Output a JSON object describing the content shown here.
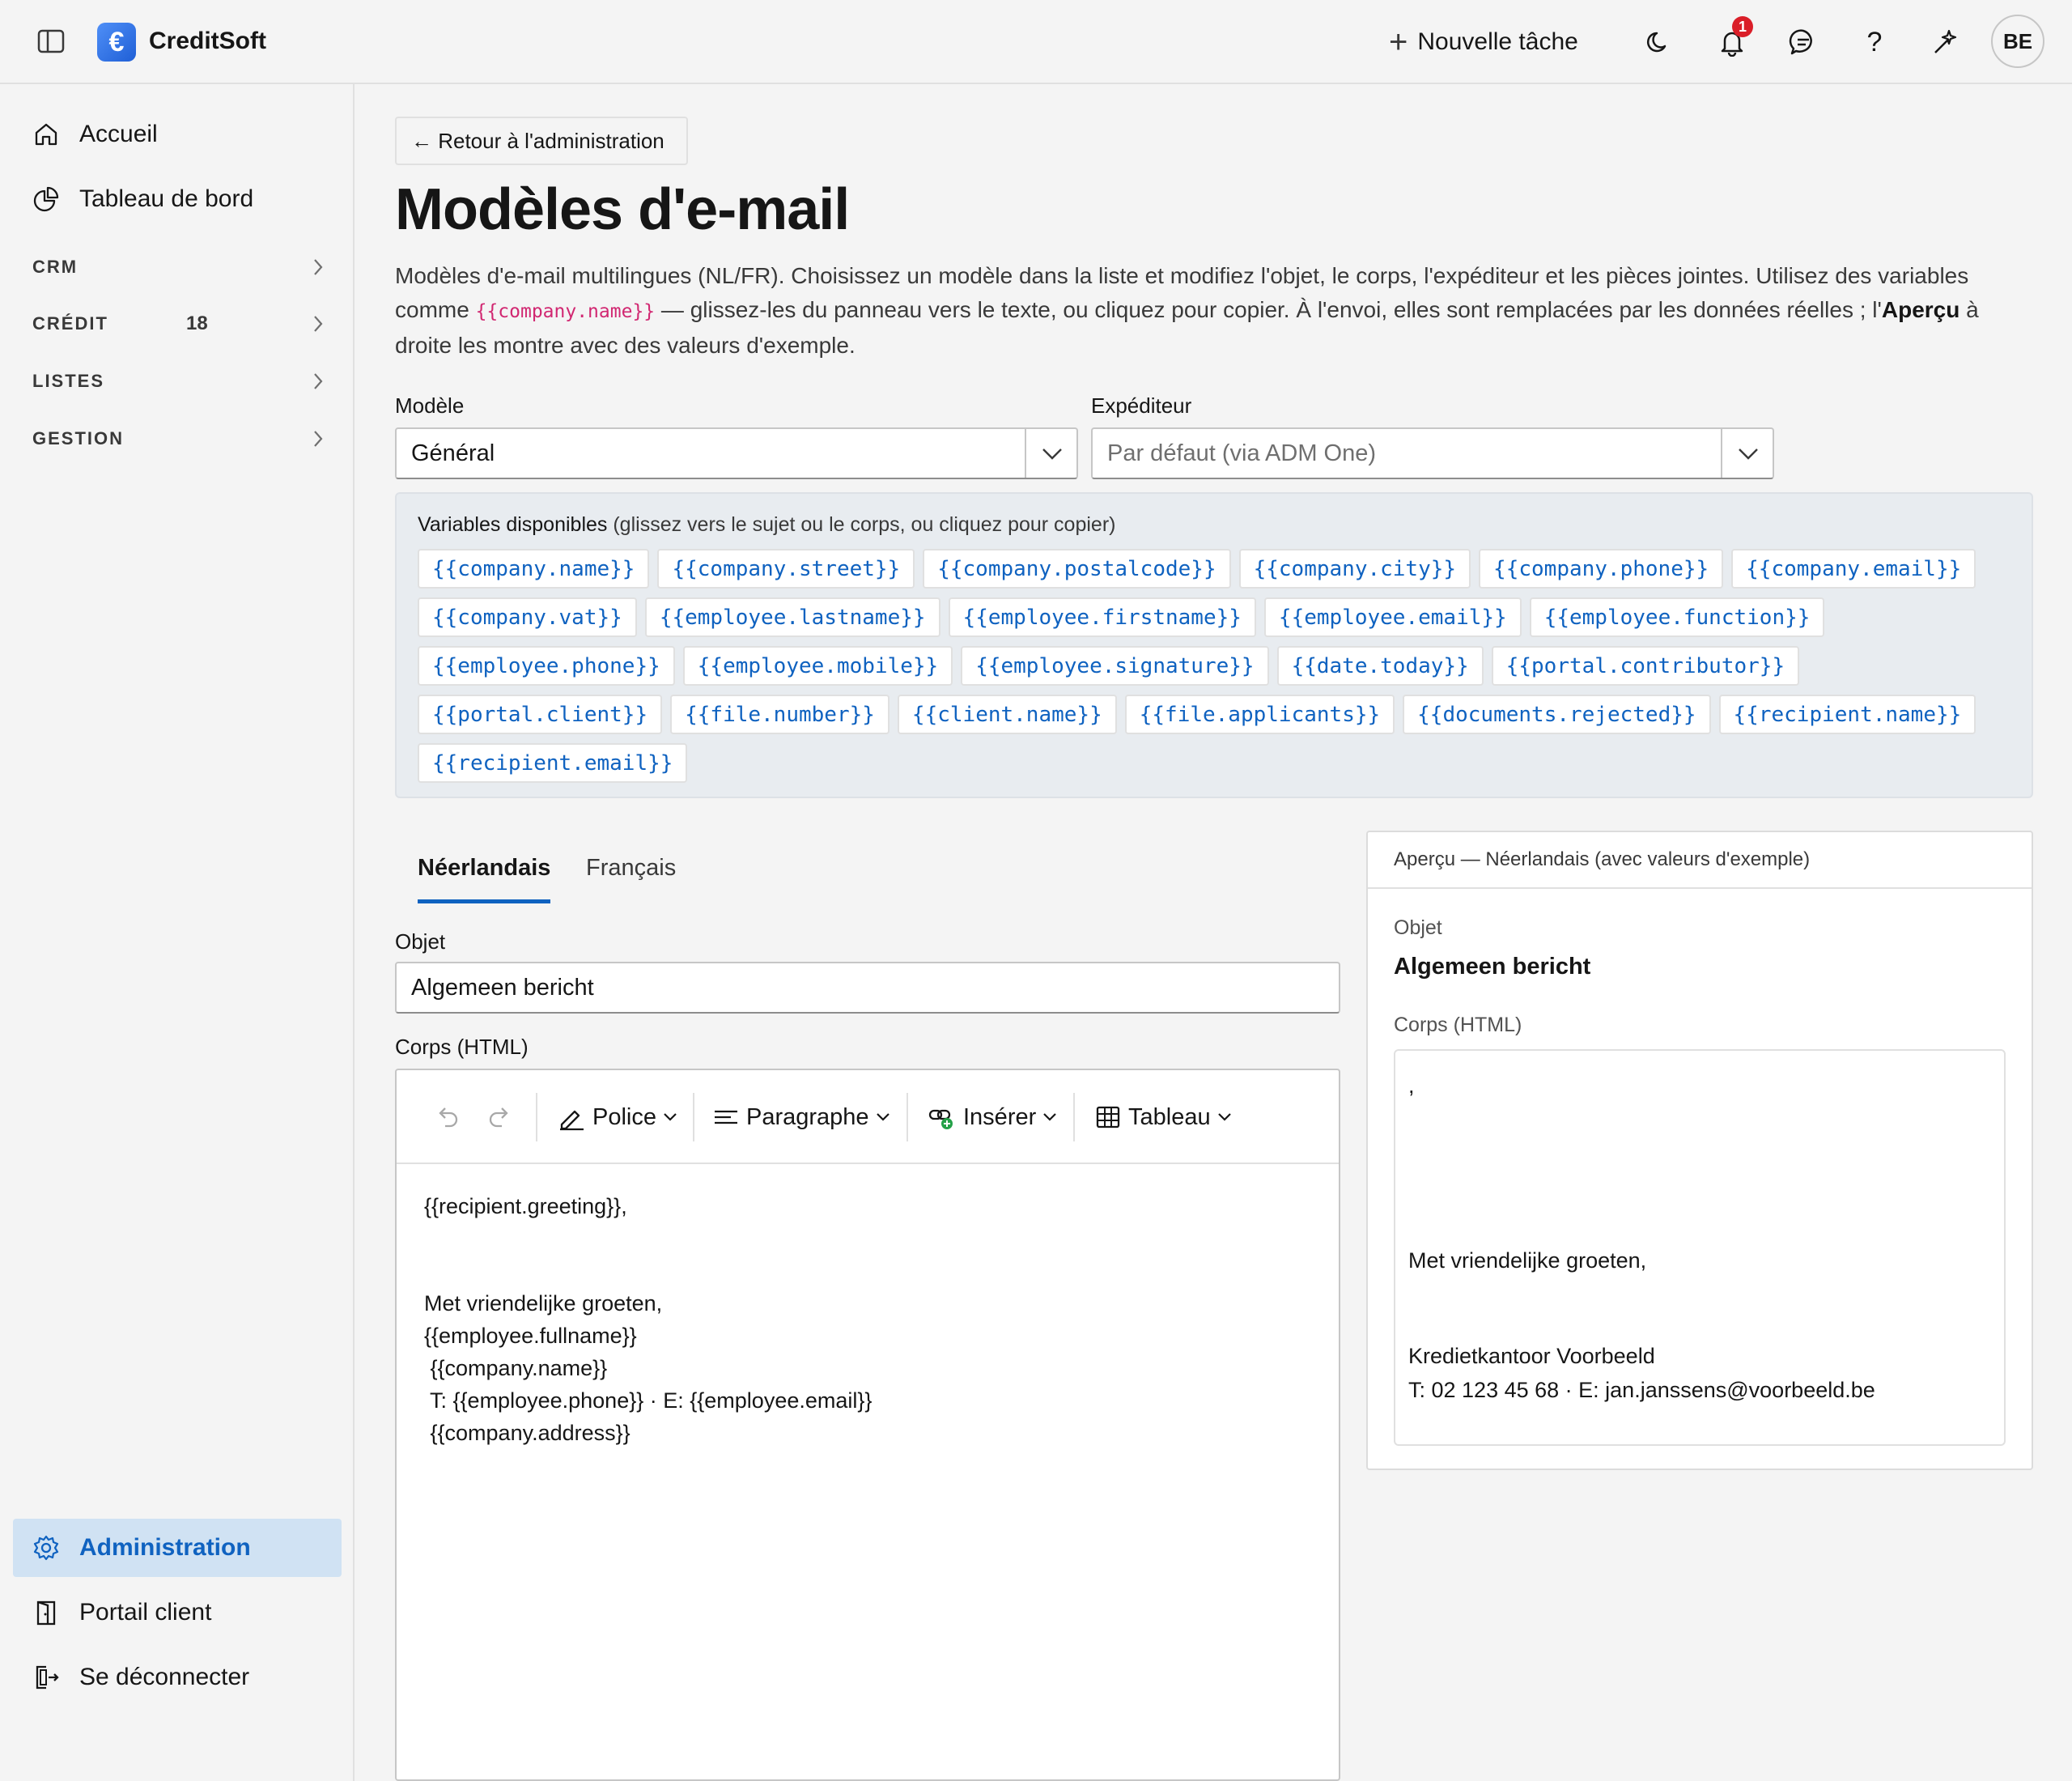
{
  "app": {
    "brand": "CreditSoft",
    "logo_glyph": "€",
    "new_task": "Nouvelle tâche",
    "notification_count": "1",
    "avatar_initials": "BE",
    "accent_color": "#0f62c0"
  },
  "sidebar": {
    "top_items": [
      {
        "label": "Accueil",
        "icon": "home-icon"
      },
      {
        "label": "Tableau de bord",
        "icon": "pie-chart-icon"
      }
    ],
    "sections": [
      {
        "label": "CRM"
      },
      {
        "label": "CRÉDIT",
        "count": "18"
      },
      {
        "label": "LISTES"
      },
      {
        "label": "GESTION"
      }
    ],
    "bottom_items": [
      {
        "label": "Administration",
        "icon": "gear-icon",
        "active": true
      },
      {
        "label": "Portail client",
        "icon": "door-icon"
      },
      {
        "label": "Se déconnecter",
        "icon": "logout-icon"
      }
    ]
  },
  "main": {
    "back_label": "← Retour à l'administration",
    "title": "Modèles d'e-mail",
    "description": {
      "part1": "Modèles d'e-mail multilingues (NL/FR). Choisissez un modèle dans la liste et modifiez l'objet, le corps, l'expéditeur et les pièces jointes. Utilisez des variables comme ",
      "code": "{{company.name}}",
      "part2": " — glissez-les du panneau vers le texte, ou cliquez pour copier. À l'envoi, elles sont remplacées par les données réelles ; l'",
      "bold": "Aperçu",
      "part3": " à droite les montre avec des valeurs d'exemple."
    },
    "template_label": "Modèle",
    "template_value": "Général",
    "sender_label": "Expéditeur",
    "sender_placeholder": "Par défaut (via ADM One)",
    "variables": {
      "title_bold": "Variables disponibles",
      "title_rest": " (glissez vers le sujet ou le corps, ou cliquez pour copier)",
      "chips": [
        "{{company.name}}",
        "{{company.street}}",
        "{{company.postalcode}}",
        "{{company.city}}",
        "{{company.phone}}",
        "{{company.email}}",
        "{{company.vat}}",
        "{{employee.lastname}}",
        "{{employee.firstname}}",
        "{{employee.email}}",
        "{{employee.function}}",
        "{{employee.phone}}",
        "{{employee.mobile}}",
        "{{employee.signature}}",
        "{{date.today}}",
        "{{portal.contributor}}",
        "{{portal.client}}",
        "{{file.number}}",
        "{{client.name}}",
        "{{file.applicants}}",
        "{{documents.rejected}}",
        "{{recipient.name}}",
        "{{recipient.email}}"
      ]
    },
    "tabs": [
      {
        "label": "Néerlandais",
        "active": true
      },
      {
        "label": "Français",
        "active": false
      }
    ],
    "subject_label": "Objet",
    "subject_value": "Algemeen bericht",
    "body_label": "Corps (HTML)",
    "toolbar": {
      "font": "Police",
      "paragraph": "Paragraphe",
      "insert": "Insérer",
      "table": "Tableau"
    },
    "body_lines": [
      "{{recipient.greeting}},",
      "",
      "",
      "Met vriendelijke groeten,",
      "{{employee.fullname}}",
      " {{company.name}}",
      " T: {{employee.phone}} · E: {{employee.email}}",
      " {{company.address}}"
    ]
  },
  "preview": {
    "header": "Aperçu — Néerlandais (avec valeurs d'exemple)",
    "subject_label": "Objet",
    "subject_value": "Algemeen bericht",
    "body_label": "Corps (HTML)",
    "body_lines": [
      ",",
      "Met vriendelijke groeten,",
      "Kredietkantoor Voorbeeld",
      "T: 02 123 45 68 · E: jan.janssens@voorbeeld.be"
    ]
  }
}
